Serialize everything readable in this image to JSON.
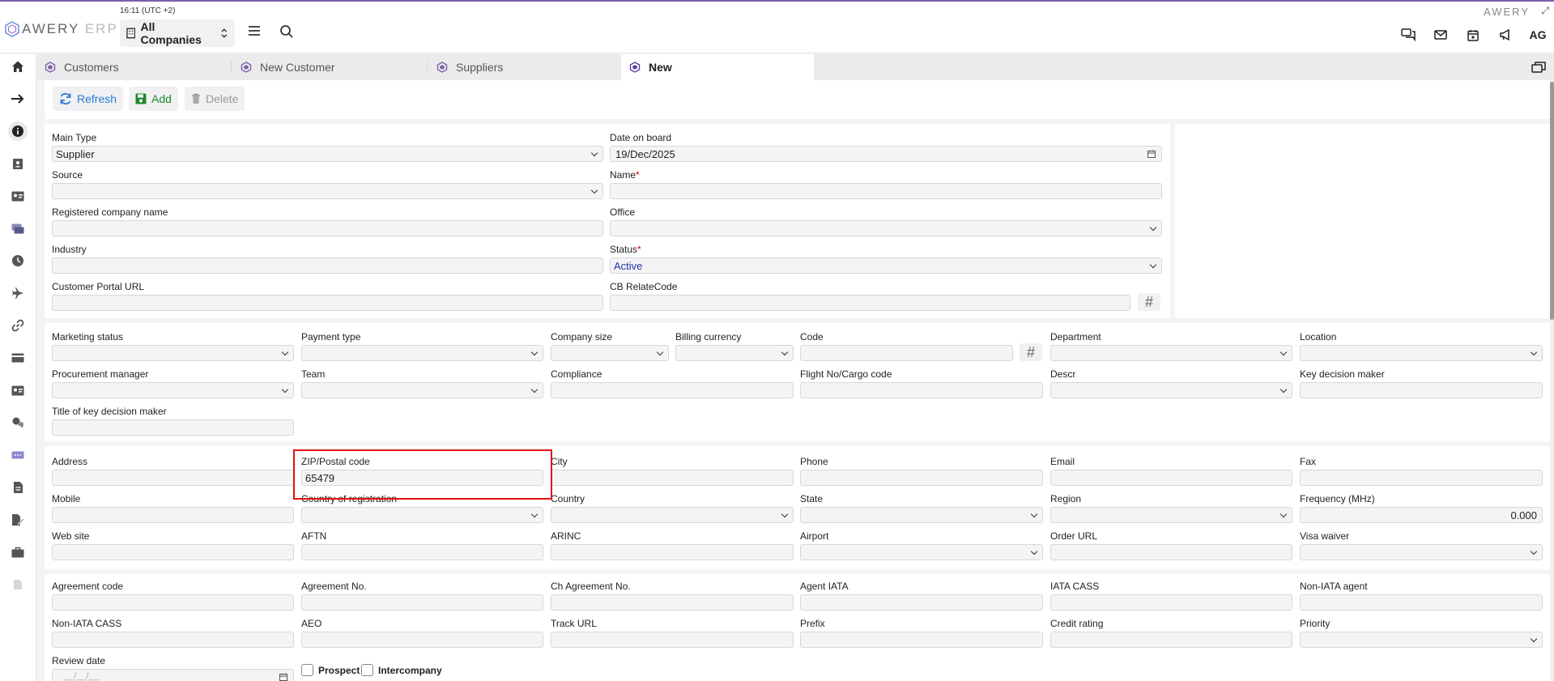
{
  "header": {
    "logo": {
      "main": "AWERY",
      "suffix": "ERP"
    },
    "clock": "16:11 (UTC +2)",
    "company_select": "All Companies",
    "brand_right": "AWERY",
    "avatar": "AG"
  },
  "tabs": [
    {
      "label": "Customers"
    },
    {
      "label": "New Customer"
    },
    {
      "label": "Suppliers"
    },
    {
      "label": "New"
    }
  ],
  "toolbar": {
    "refresh": "Refresh",
    "add": "Add",
    "delete": "Delete"
  },
  "colors": {
    "accent": "#6a4ea0",
    "refresh": "#2a7bd5",
    "add": "#1a8a2a",
    "highlight": "#e01010"
  },
  "section1": {
    "main_type": {
      "label": "Main Type",
      "value": "Supplier"
    },
    "date_on_board": {
      "label": "Date on board",
      "value": "19/Dec/2025"
    },
    "source": {
      "label": "Source",
      "value": ""
    },
    "name": {
      "label": "Name",
      "value": ""
    },
    "registered_company_name": {
      "label": "Registered company name",
      "value": ""
    },
    "office": {
      "label": "Office",
      "value": ""
    },
    "industry": {
      "label": "Industry",
      "value": ""
    },
    "status": {
      "label": "Status",
      "value": "Active"
    },
    "customer_portal_url": {
      "label": "Customer Portal URL",
      "value": ""
    },
    "cb_relatecode": {
      "label": "CB RelateCode",
      "value": ""
    }
  },
  "section2": {
    "marketing_status": "Marketing status",
    "payment_type": "Payment type",
    "company_size": "Company size",
    "billing_currency": "Billing currency",
    "code": "Code",
    "department": "Department",
    "location": "Location",
    "procurement_manager": "Procurement manager",
    "team": "Team",
    "compliance": "Compliance",
    "flight_no": "Flight No/Cargo code",
    "descr": "Descr",
    "key_decision_maker": "Key decision maker",
    "title_key_decision_maker": "Title of key decision maker"
  },
  "section3": {
    "address": "Address",
    "zip": {
      "label": "ZIP/Postal code",
      "value": "65479"
    },
    "city": "City",
    "phone": "Phone",
    "email": "Email",
    "fax": "Fax",
    "mobile": "Mobile",
    "country_of_registration": "Country of registration",
    "country": "Country",
    "state": "State",
    "region": "Region",
    "frequency": {
      "label": "Frequency (MHz)",
      "value": "0.000"
    },
    "web_site": "Web site",
    "aftn": "AFTN",
    "arinc": "ARINC",
    "airport": "Airport",
    "order_url": "Order URL",
    "visa_waiver": "Visa waiver"
  },
  "section4": {
    "agreement_code": "Agreement code",
    "agreement_no": "Agreement No.",
    "ch_agreement_no": "Ch Agreement No.",
    "agent_iata": "Agent IATA",
    "iata_cass": "IATA CASS",
    "non_iata_agent": "Non-IATA agent",
    "non_iata_cass": "Non-IATA CASS",
    "aeo": "AEO",
    "track_url": "Track URL",
    "prefix": "Prefix",
    "credit_rating": "Credit rating",
    "priority": "Priority",
    "review_date": {
      "label": "Review date",
      "placeholder": "__/__/__"
    },
    "prospect": "Prospect",
    "intercompany": "Intercompany"
  }
}
